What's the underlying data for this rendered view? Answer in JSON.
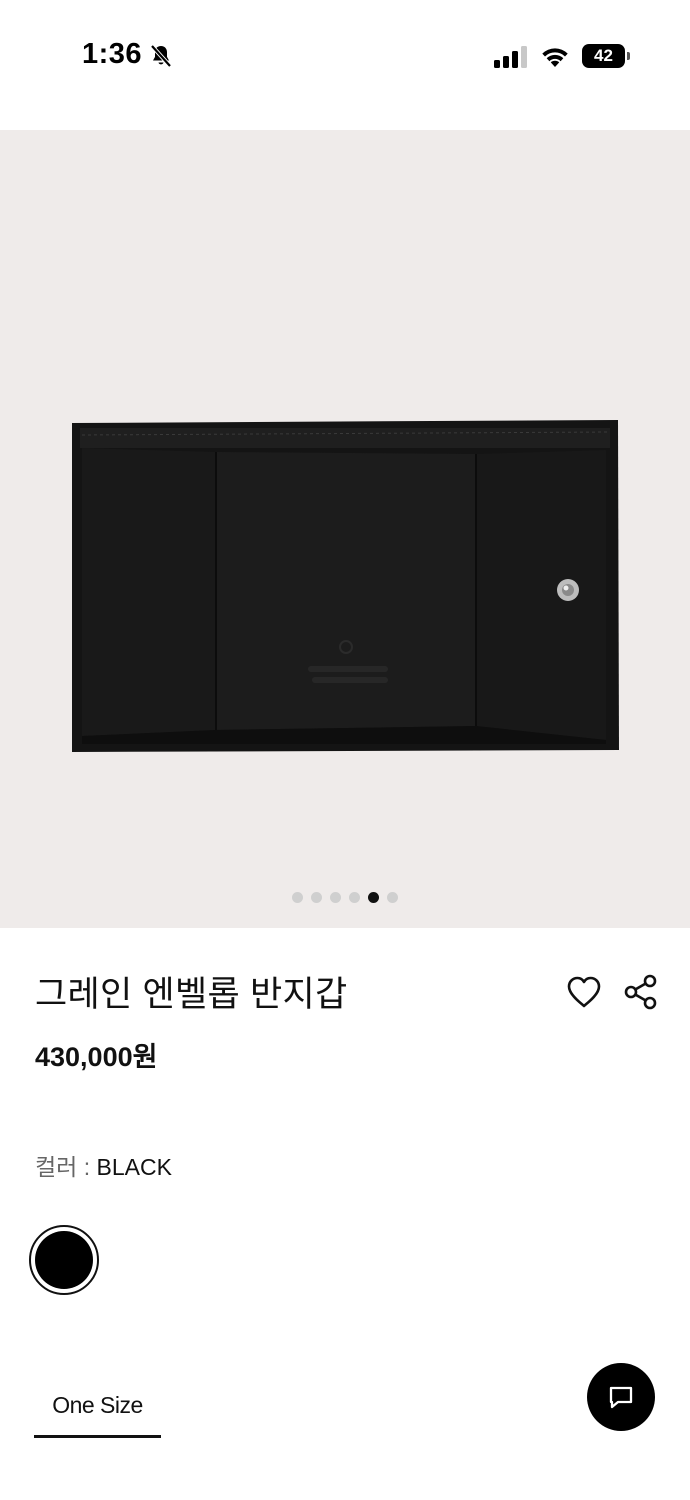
{
  "status_bar": {
    "time": "1:36",
    "battery": "42",
    "icons": [
      "bell-slash-icon",
      "signal-icon",
      "wifi-icon",
      "battery-icon"
    ]
  },
  "gallery": {
    "image": "wallet-product-photo",
    "page_count": 6,
    "active_index": 4,
    "background": "#efebea"
  },
  "product": {
    "title": "그레인 엔벨롭 반지갑",
    "price": "430,000원",
    "color_key": "컬러 : ",
    "color_value": "BLACK",
    "swatch_color": "#000000",
    "size_label": "One Size"
  },
  "actions": {
    "wishlist_icon": "heart-icon",
    "share_icon": "share-icon",
    "chat_icon": "chat-icon"
  }
}
